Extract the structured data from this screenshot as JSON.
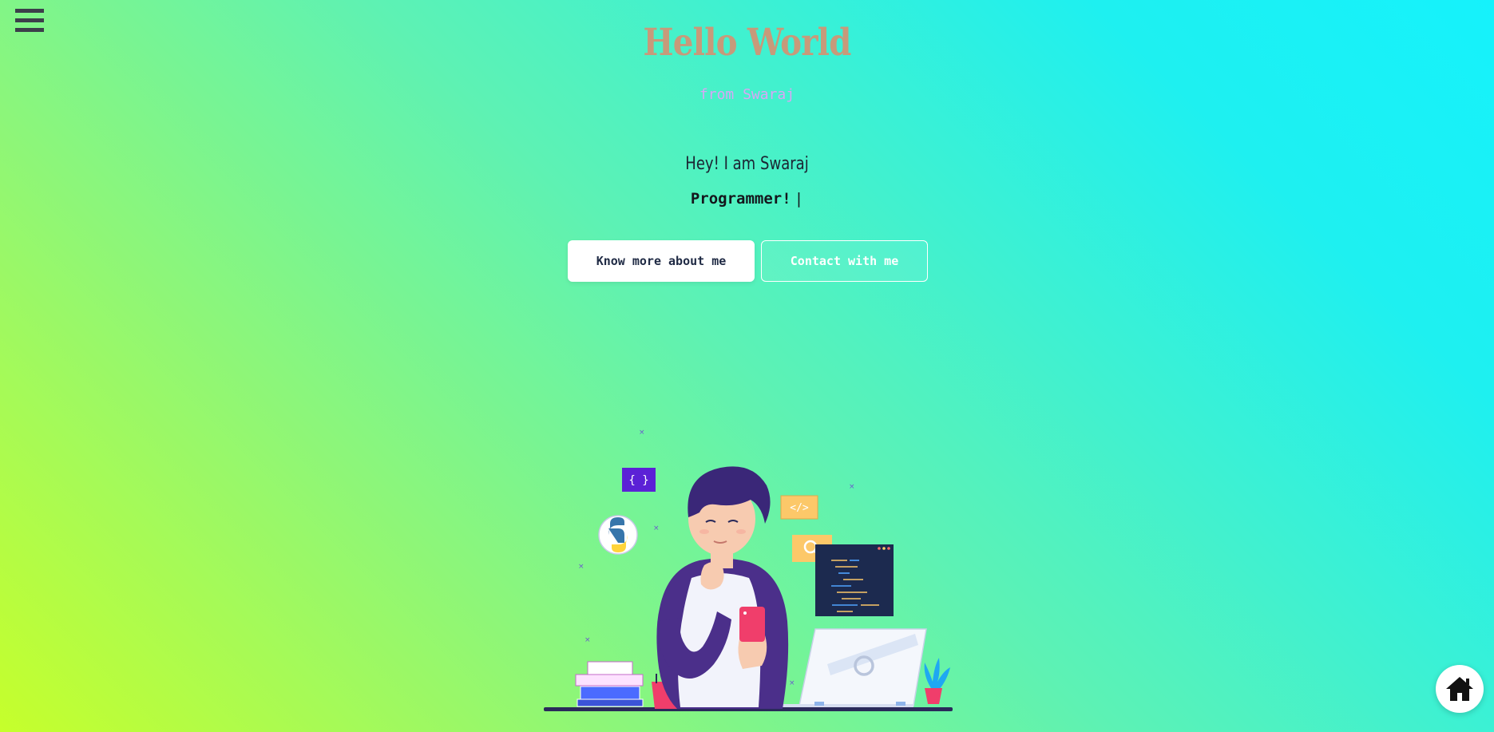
{
  "header": {
    "title": "Hello World",
    "subtitle": "from Swaraj",
    "menu_icon": "hamburger-menu-icon"
  },
  "hero": {
    "greeting": "Hey! I am Swaraj",
    "role": "Programmer!",
    "cursor": "|"
  },
  "actions": {
    "know_more_label": "Know more about me",
    "contact_label": "Contact with me"
  },
  "illustration": {
    "badge_braces": "{ }",
    "badge_code": "</>",
    "icons": [
      "python-logo-icon",
      "search-icon",
      "code-window-icon",
      "laptop-icon",
      "phone-icon",
      "coffee-mug-icon",
      "books-icon",
      "plant-icon"
    ]
  },
  "floating": {
    "home_icon": "home-icon"
  },
  "colors": {
    "title": "#c79a7a",
    "subtitle": "#d8a6f5",
    "gradient_start": "#c6ff2b",
    "gradient_end": "#15f2fc"
  }
}
